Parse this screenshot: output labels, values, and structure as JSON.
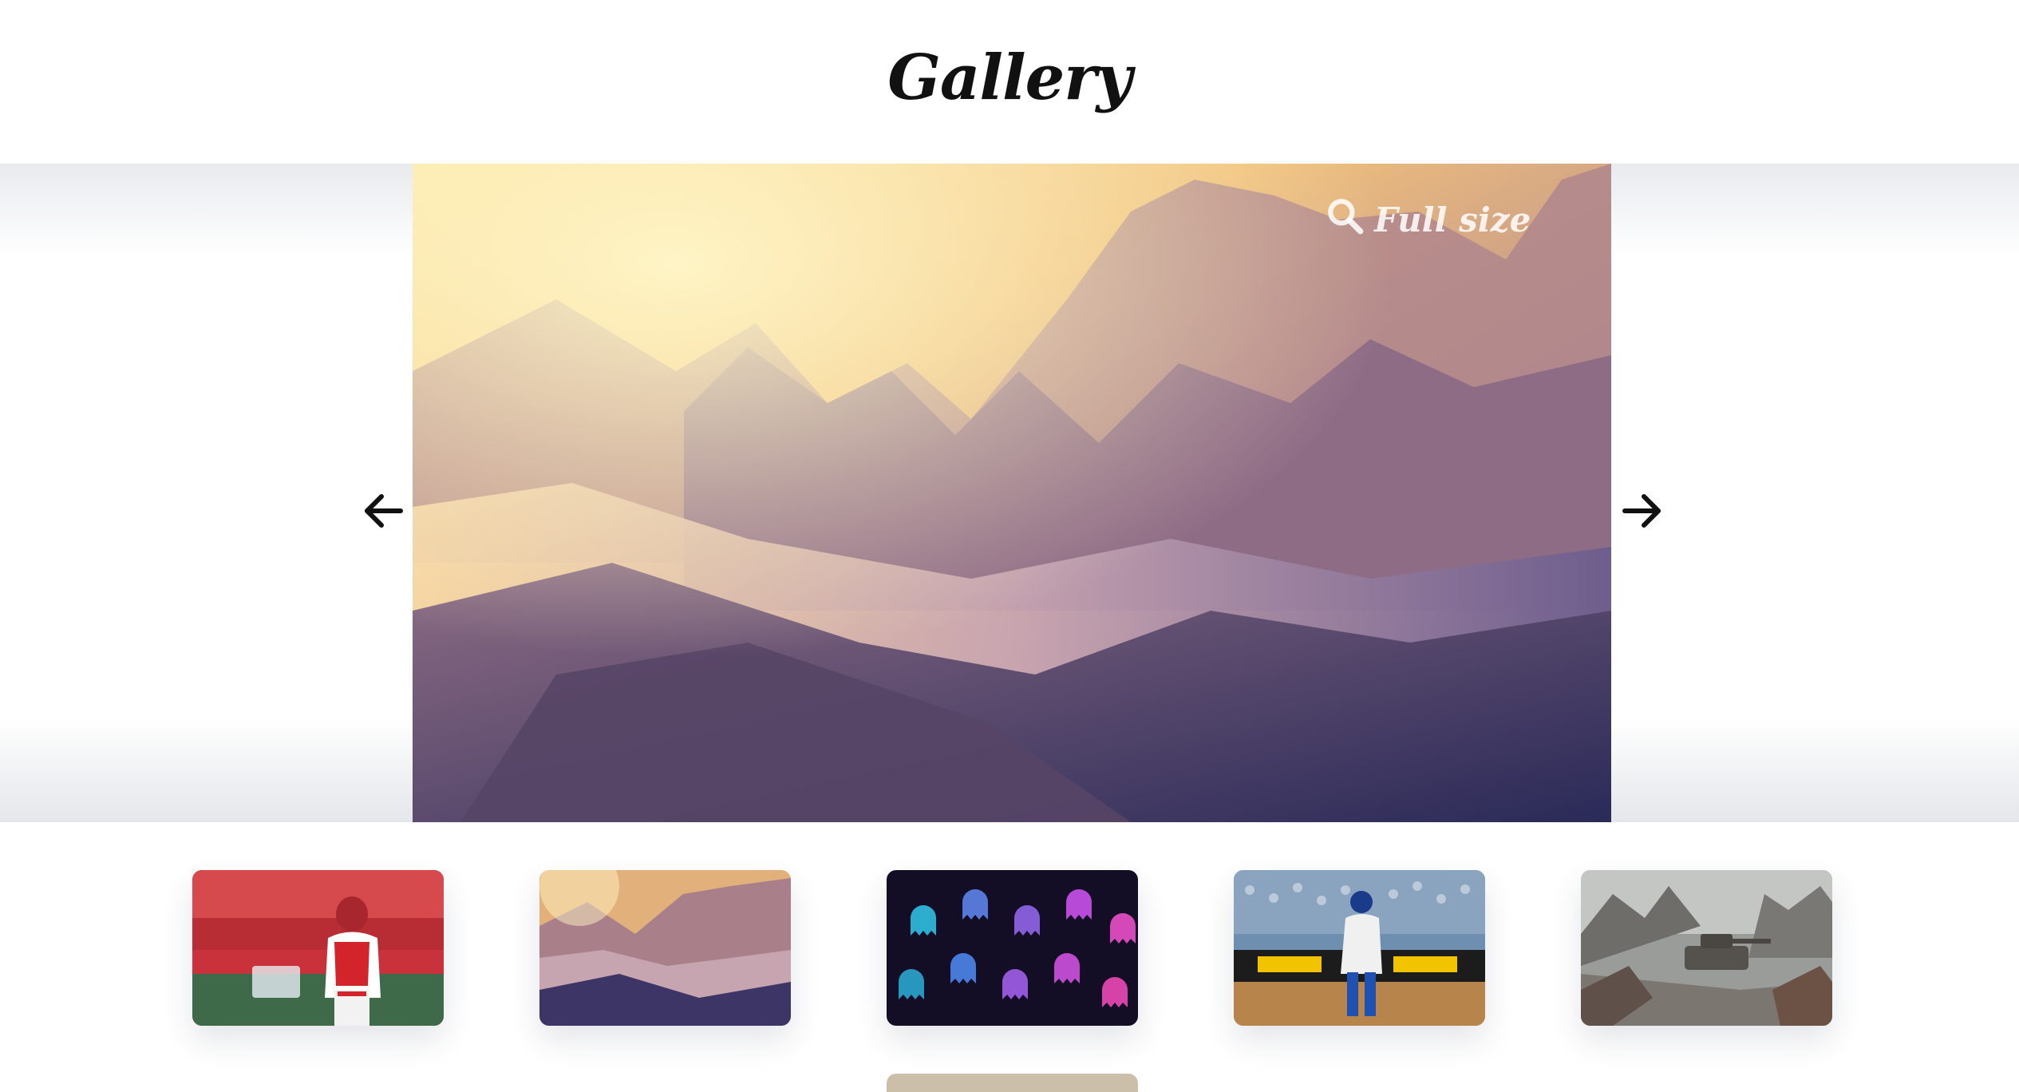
{
  "page": {
    "title": "Gallery"
  },
  "viewer": {
    "fullsize_label": "Full size",
    "fullsize_icon": "search-icon",
    "prev_icon": "arrow-left-icon",
    "next_icon": "arrow-right-icon",
    "current_image": "snowy-mountain-landscape"
  },
  "thumbnails": [
    {
      "subject": "baseball-catcher-red-uniform"
    },
    {
      "subject": "snowy-mountain-landscape"
    },
    {
      "subject": "pacman-ghost-pattern"
    },
    {
      "subject": "baseball-catcher-blue-uniform"
    },
    {
      "subject": "tanks-battlefield"
    }
  ],
  "colors": {
    "title": "#111111",
    "arrow": "#111111",
    "fullsize_text": "#ffffff",
    "page_background": "#ffffff"
  }
}
